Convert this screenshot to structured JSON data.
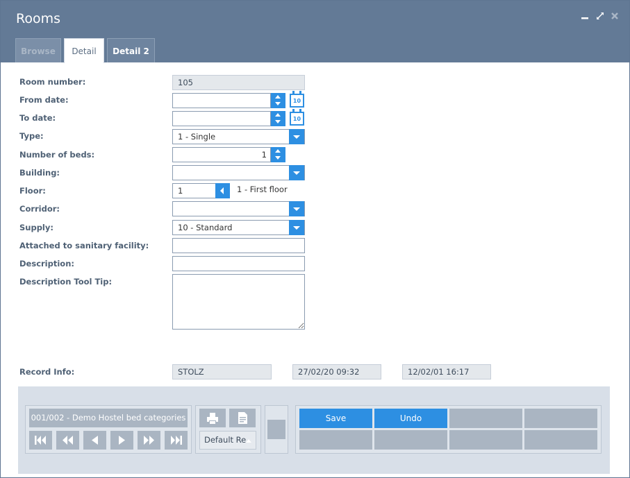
{
  "window": {
    "title": "Rooms"
  },
  "tabs": [
    {
      "label": "Browse"
    },
    {
      "label": "Detail"
    },
    {
      "label": "Detail 2"
    }
  ],
  "form": {
    "room_number": {
      "label": "Room number:",
      "value": "105"
    },
    "from_date": {
      "label": "From date:",
      "value": ""
    },
    "to_date": {
      "label": "To date:",
      "value": ""
    },
    "type": {
      "label": "Type:",
      "value": "1 - Single"
    },
    "number_of_beds": {
      "label": "Number of beds:",
      "value": "1"
    },
    "building": {
      "label": "Building:",
      "value": ""
    },
    "floor": {
      "label": "Floor:",
      "value": "1",
      "description": "1 - First floor"
    },
    "corridor": {
      "label": "Corridor:",
      "value": ""
    },
    "supply": {
      "label": "Supply:",
      "value": "10 - Standard"
    },
    "sanitary": {
      "label": "Attached to sanitary facility:",
      "value": ""
    },
    "description": {
      "label": "Description:",
      "value": ""
    },
    "tooltip": {
      "label": "Description Tool Tip:",
      "value": ""
    },
    "calendar_icon_text": "10"
  },
  "record_info": {
    "label": "Record Info:",
    "user": "STOLZ",
    "created": "27/02/20 09:32",
    "modified": "12/02/01 16:17"
  },
  "toolbar": {
    "record_position": "001/002 - Demo Hostel bed categories",
    "report": "Default Re",
    "save_label": "Save",
    "undo_label": "Undo"
  },
  "colors": {
    "titlebar": "#637a96",
    "accent": "#2d8fe2",
    "toolbar_bg": "#d8dfe8",
    "button_gray": "#aab5c2"
  },
  "icons": [
    "minimize-icon",
    "maximize-icon",
    "close-icon",
    "calendar-icon",
    "print-icon",
    "report-icon",
    "first-record-icon",
    "prev-page-icon",
    "prev-record-icon",
    "next-record-icon",
    "next-page-icon",
    "last-record-icon"
  ]
}
